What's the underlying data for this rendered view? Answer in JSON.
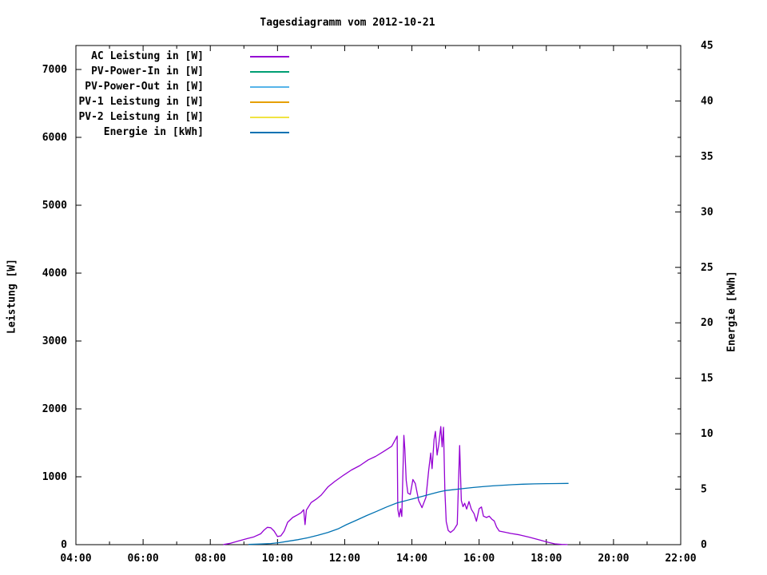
{
  "title": "Tagesdiagramm vom 2012-10-21",
  "chart_data": {
    "type": "line",
    "title": "Tagesdiagramm vom 2012-10-21",
    "grid": false,
    "legend_position": "top-left-inside",
    "x_axis": {
      "tick_hours": [
        4,
        6,
        8,
        10,
        12,
        14,
        16,
        18,
        20,
        22
      ],
      "tick_labels": [
        "04:00",
        "06:00",
        "08:00",
        "10:00",
        "12:00",
        "14:00",
        "16:00",
        "18:00",
        "20:00",
        "22:00"
      ],
      "minor_hours": [
        5,
        7,
        9,
        11,
        13,
        15,
        17,
        19,
        21
      ],
      "range_hours": [
        4,
        22
      ]
    },
    "y_left": {
      "label": "Leistung [W]",
      "ticks": [
        0,
        1000,
        2000,
        3000,
        4000,
        5000,
        6000,
        7000
      ],
      "range": [
        0,
        7353
      ]
    },
    "y_right": {
      "label": "Energie [kWh]",
      "ticks": [
        0,
        5,
        10,
        15,
        20,
        25,
        30,
        35,
        40,
        45
      ],
      "range": [
        0,
        45
      ]
    },
    "series": [
      {
        "name": "AC Leistung in [W]",
        "color": "#9400d3",
        "axis": "left",
        "points": [
          [
            8.4,
            2
          ],
          [
            8.6,
            20
          ],
          [
            8.85,
            55
          ],
          [
            9.1,
            90
          ],
          [
            9.3,
            115
          ],
          [
            9.5,
            160
          ],
          [
            9.6,
            215
          ],
          [
            9.7,
            255
          ],
          [
            9.8,
            250
          ],
          [
            9.9,
            200
          ],
          [
            10.0,
            120
          ],
          [
            10.1,
            130
          ],
          [
            10.2,
            200
          ],
          [
            10.3,
            330
          ],
          [
            10.45,
            400
          ],
          [
            10.6,
            440
          ],
          [
            10.7,
            470
          ],
          [
            10.78,
            515
          ],
          [
            10.82,
            295
          ],
          [
            10.86,
            510
          ],
          [
            11.0,
            620
          ],
          [
            11.15,
            670
          ],
          [
            11.3,
            730
          ],
          [
            11.5,
            850
          ],
          [
            11.7,
            930
          ],
          [
            11.97,
            1025
          ],
          [
            12.2,
            1100
          ],
          [
            12.45,
            1165
          ],
          [
            12.7,
            1250
          ],
          [
            12.92,
            1300
          ],
          [
            13.15,
            1370
          ],
          [
            13.4,
            1450
          ],
          [
            13.5,
            1540
          ],
          [
            13.56,
            1600
          ],
          [
            13.58,
            520
          ],
          [
            13.62,
            410
          ],
          [
            13.66,
            530
          ],
          [
            13.7,
            415
          ],
          [
            13.76,
            1610
          ],
          [
            13.79,
            1410
          ],
          [
            13.83,
            950
          ],
          [
            13.88,
            760
          ],
          [
            13.95,
            740
          ],
          [
            14.03,
            960
          ],
          [
            14.1,
            900
          ],
          [
            14.2,
            650
          ],
          [
            14.3,
            545
          ],
          [
            14.42,
            700
          ],
          [
            14.5,
            1100
          ],
          [
            14.56,
            1350
          ],
          [
            14.6,
            1120
          ],
          [
            14.66,
            1550
          ],
          [
            14.7,
            1670
          ],
          [
            14.75,
            1320
          ],
          [
            14.8,
            1480
          ],
          [
            14.86,
            1740
          ],
          [
            14.9,
            1440
          ],
          [
            14.94,
            1730
          ],
          [
            14.98,
            800
          ],
          [
            15.02,
            340
          ],
          [
            15.08,
            210
          ],
          [
            15.15,
            180
          ],
          [
            15.25,
            220
          ],
          [
            15.35,
            300
          ],
          [
            15.42,
            1460
          ],
          [
            15.47,
            650
          ],
          [
            15.52,
            560
          ],
          [
            15.57,
            610
          ],
          [
            15.63,
            525
          ],
          [
            15.7,
            635
          ],
          [
            15.77,
            520
          ],
          [
            15.85,
            455
          ],
          [
            15.92,
            345
          ],
          [
            16.0,
            530
          ],
          [
            16.07,
            555
          ],
          [
            16.13,
            420
          ],
          [
            16.22,
            400
          ],
          [
            16.3,
            420
          ],
          [
            16.38,
            375
          ],
          [
            16.45,
            350
          ],
          [
            16.52,
            260
          ],
          [
            16.6,
            200
          ],
          [
            16.75,
            185
          ],
          [
            16.95,
            165
          ],
          [
            17.2,
            145
          ],
          [
            17.5,
            110
          ],
          [
            17.8,
            70
          ],
          [
            18.05,
            35
          ],
          [
            18.25,
            12
          ],
          [
            18.45,
            3
          ],
          [
            18.62,
            1
          ]
        ]
      },
      {
        "name": "PV-Power-In in [W]",
        "color": "#009e73",
        "axis": "left",
        "points": []
      },
      {
        "name": "PV-Power-Out in [W]",
        "color": "#56b4e9",
        "axis": "left",
        "points": []
      },
      {
        "name": "PV-1 Leistung in [W]",
        "color": "#e69f00",
        "axis": "left",
        "points": []
      },
      {
        "name": "PV-2 Leistung in [W]",
        "color": "#f0e442",
        "axis": "left",
        "points": []
      },
      {
        "name": "Energie in [kWh]",
        "color": "#0072b2",
        "axis": "right",
        "points": [
          [
            9.15,
            0.02
          ],
          [
            9.5,
            0.06
          ],
          [
            9.8,
            0.1
          ],
          [
            10.05,
            0.18
          ],
          [
            10.3,
            0.3
          ],
          [
            10.6,
            0.45
          ],
          [
            10.9,
            0.62
          ],
          [
            11.2,
            0.85
          ],
          [
            11.5,
            1.1
          ],
          [
            11.8,
            1.42
          ],
          [
            12.05,
            1.8
          ],
          [
            12.35,
            2.2
          ],
          [
            12.65,
            2.62
          ],
          [
            12.95,
            3.0
          ],
          [
            13.25,
            3.4
          ],
          [
            13.55,
            3.75
          ],
          [
            13.8,
            3.95
          ],
          [
            14.05,
            4.15
          ],
          [
            14.3,
            4.35
          ],
          [
            14.55,
            4.55
          ],
          [
            14.8,
            4.75
          ],
          [
            15.0,
            4.88
          ],
          [
            15.2,
            4.95
          ],
          [
            15.5,
            5.05
          ],
          [
            15.8,
            5.15
          ],
          [
            16.1,
            5.23
          ],
          [
            16.4,
            5.3
          ],
          [
            16.7,
            5.36
          ],
          [
            17.0,
            5.41
          ],
          [
            17.3,
            5.45
          ],
          [
            17.65,
            5.48
          ],
          [
            18.0,
            5.5
          ],
          [
            18.3,
            5.51
          ],
          [
            18.65,
            5.52
          ]
        ]
      }
    ]
  }
}
